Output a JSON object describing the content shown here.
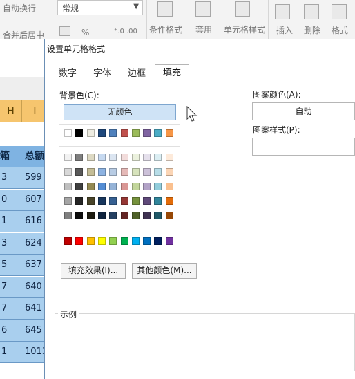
{
  "ribbon": {
    "wrap_text": "自动换行",
    "merge_center": "合并后居中",
    "number_format": "常规",
    "percent_symbol": "%",
    "decimal_symbol": "⁺.0 .00",
    "conditional_format": "条件格式",
    "apply_table": "套用",
    "cell_style": "单元格样式",
    "insert": "插入",
    "delete": "删除",
    "format": "格式"
  },
  "sheet": {
    "col_h": "H",
    "col_i": "I",
    "header_h": "箱",
    "header_i": "总额",
    "rows": [
      {
        "h": "3",
        "i": "599"
      },
      {
        "h": "0",
        "i": "607"
      },
      {
        "h": "1",
        "i": "616"
      },
      {
        "h": "3",
        "i": "624"
      },
      {
        "h": "5",
        "i": "637"
      },
      {
        "h": "7",
        "i": "640"
      },
      {
        "h": "7",
        "i": "641"
      },
      {
        "h": "6",
        "i": "645"
      },
      {
        "h": "1",
        "i": "1013"
      }
    ]
  },
  "dialog": {
    "title": "设置单元格格式",
    "tabs": [
      "数字",
      "字体",
      "边框",
      "填充"
    ],
    "active_tab": "填充",
    "background_color_label": "背景色(C):",
    "no_color_button": "无颜色",
    "fill_effects_button": "填充效果(I)...",
    "more_colors_button": "其他颜色(M)...",
    "pattern_color_label": "图案颜色(A):",
    "pattern_color_value": "自动",
    "pattern_style_label": "图案样式(P):",
    "pattern_style_value": "",
    "sample_label": "示例"
  },
  "palette": {
    "theme_row": [
      "#ffffff",
      "#000000",
      "#eeece1",
      "#1f497d",
      "#4f81bd",
      "#c0504d",
      "#9bbb59",
      "#8064a2",
      "#4bacc6",
      "#f79646"
    ],
    "tint_rows": [
      [
        "#f2f2f2",
        "#7f7f7f",
        "#ddd9c3",
        "#c6d9f0",
        "#dbe5f1",
        "#f2dcdb",
        "#ebf1dd",
        "#e5e0ec",
        "#dbeef3",
        "#fdeada"
      ],
      [
        "#d8d8d8",
        "#595959",
        "#c4bd97",
        "#8db3e2",
        "#b8cce4",
        "#e5b9b7",
        "#d7e3bc",
        "#ccc1d9",
        "#b7dde8",
        "#fbd5b5"
      ],
      [
        "#bfbfbf",
        "#3f3f3f",
        "#938953",
        "#548dd4",
        "#95b3d7",
        "#d99694",
        "#c3d69b",
        "#b2a2c7",
        "#92cddc",
        "#fac08f"
      ],
      [
        "#a5a5a5",
        "#262626",
        "#494429",
        "#17365d",
        "#366092",
        "#953734",
        "#76923c",
        "#5f497a",
        "#31859b",
        "#e36c09"
      ],
      [
        "#7f7f7f",
        "#0c0c0c",
        "#1d1b10",
        "#0f243e",
        "#244061",
        "#632423",
        "#4f6128",
        "#3f3151",
        "#205867",
        "#974806"
      ]
    ],
    "standard_row": [
      "#c00000",
      "#ff0000",
      "#ffc000",
      "#ffff00",
      "#92d050",
      "#00b050",
      "#00b0f0",
      "#0070c0",
      "#002060",
      "#7030a0"
    ]
  }
}
